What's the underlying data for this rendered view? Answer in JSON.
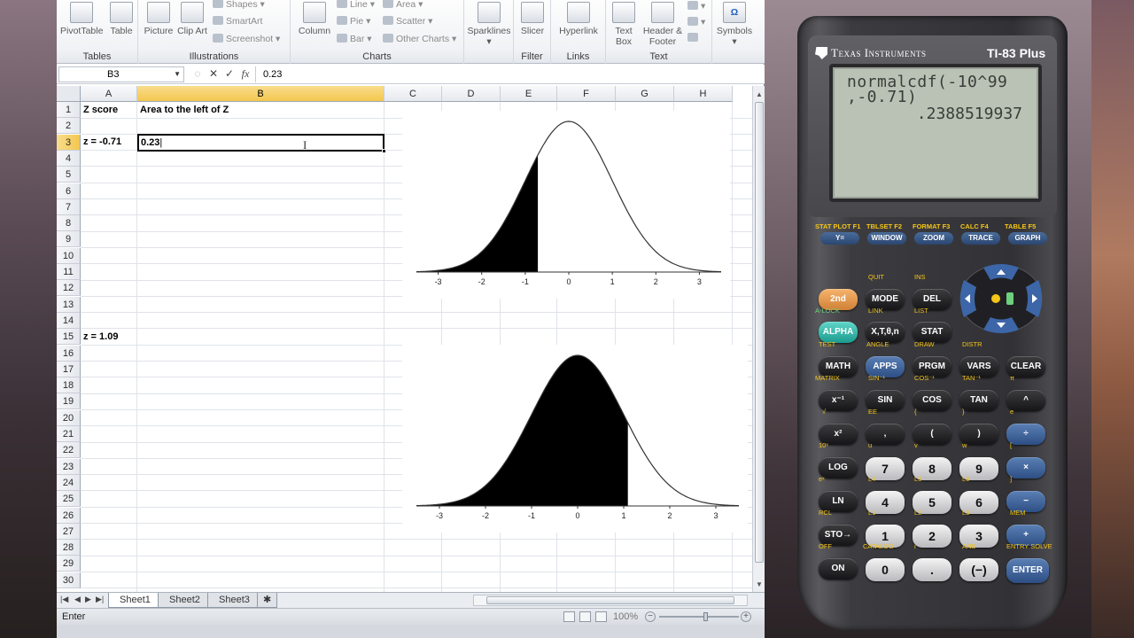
{
  "ribbon": {
    "groups": [
      {
        "title": "Tables",
        "buttons": [
          "PivotTable",
          "Table"
        ]
      },
      {
        "title": "Illustrations",
        "buttons": [
          "Picture",
          "Clip Art"
        ],
        "small": [
          "Shapes",
          "SmartArt",
          "Screenshot"
        ]
      },
      {
        "title": "Charts",
        "buttons": [
          "Column"
        ],
        "small": [
          "Line",
          "Pie",
          "Bar",
          "Area",
          "Scatter",
          "Other Charts"
        ]
      },
      {
        "title": "",
        "buttons": [
          "Sparklines"
        ]
      },
      {
        "title": "Filter",
        "buttons": [
          "Slicer"
        ]
      },
      {
        "title": "Links",
        "buttons": [
          "Hyperlink"
        ]
      },
      {
        "title": "Text",
        "buttons": [
          "Text Box",
          "Header & Footer"
        ]
      },
      {
        "title": "",
        "buttons": [
          "Symbols"
        ]
      }
    ]
  },
  "formula_bar": {
    "name_box": "B3",
    "cancel": "✕",
    "enter": "✓",
    "fx": "fx",
    "content": "0.23"
  },
  "columns": [
    "A",
    "B",
    "C",
    "D",
    "E",
    "F",
    "G",
    "H"
  ],
  "rows": [
    "1",
    "2",
    "3",
    "4",
    "5",
    "6",
    "7",
    "8",
    "9",
    "10",
    "11",
    "12",
    "13",
    "14",
    "15",
    "16",
    "17",
    "18",
    "19",
    "20",
    "21",
    "22",
    "23",
    "24",
    "25",
    "26",
    "27",
    "28",
    "29",
    "30"
  ],
  "cells": {
    "A1": "Z score",
    "B1": "Area to the left of Z",
    "A3": "z = -0.71",
    "B3": "0.23",
    "A15": "z = 1.09"
  },
  "charts": [
    {
      "type": "area",
      "shaded_left_of": -0.71,
      "x_ticks": [
        "-3",
        "-2",
        "-1",
        "0",
        "1",
        "2",
        "3"
      ]
    },
    {
      "type": "area",
      "shaded_left_of": 1.09,
      "x_ticks": [
        "-3",
        "-2",
        "-1",
        "0",
        "1",
        "2",
        "3"
      ]
    }
  ],
  "sheet_tabs": [
    "Sheet1",
    "Sheet2",
    "Sheet3"
  ],
  "status": {
    "mode": "Enter",
    "zoom": "100%"
  },
  "calculator": {
    "brand": "Texas Instruments",
    "model": "TI-83 Plus",
    "screen_line1": "normalcdf(-10^99",
    "screen_line2": ",-0.71)",
    "screen_result": ".2388519937",
    "fn_row_labels": [
      "STAT PLOT F1",
      "TBLSET F2",
      "FORMAT F3",
      "CALC F4",
      "TABLE F5"
    ],
    "fn_keys": [
      "Y=",
      "WINDOW",
      "ZOOM",
      "TRACE",
      "GRAPH"
    ],
    "keys": {
      "second": "2nd",
      "mode": "MODE",
      "del": "DEL",
      "alpha": "ALPHA",
      "xt": "X,T,θ,n",
      "stat": "STAT",
      "math": "MATH",
      "apps": "APPS",
      "prgm": "PRGM",
      "vars": "VARS",
      "clear": "CLEAR",
      "inv": "x⁻¹",
      "sin": "SIN",
      "cos": "COS",
      "tan": "TAN",
      "pow": "^",
      "sq": "x²",
      "comma": ",",
      "lparen": "(",
      "rparen": ")",
      "div": "÷",
      "log": "LOG",
      "k7": "7",
      "k8": "8",
      "k9": "9",
      "mul": "×",
      "ln": "LN",
      "k4": "4",
      "k5": "5",
      "k6": "6",
      "minus": "−",
      "sto": "STO→",
      "k1": "1",
      "k2": "2",
      "k3": "3",
      "plus": "+",
      "on": "ON",
      "k0": "0",
      "dot": ".",
      "neg": "(−)",
      "enter": "ENTER"
    },
    "second_labels": {
      "quit": "QUIT",
      "ins": "INS",
      "alock": "A-LOCK",
      "link": "LINK",
      "list": "LIST",
      "test": "TEST",
      "angle": "ANGLE",
      "draw": "DRAW",
      "distr": "DISTR",
      "matrix": "MATRIX",
      "sin_inv": "SIN⁻¹",
      "cos_inv": "COS⁻¹",
      "tan_inv": "TAN⁻¹",
      "pi": "π",
      "sqrt": "√",
      "ee": "EE",
      "lbrace": "{",
      "rbrace": "}",
      "e": "e",
      "tenx": "10ˣ",
      "u": "u",
      "v": "v",
      "w": "w",
      "lbrack": "[",
      "ex": "eˣ",
      "l4": "L4",
      "l5": "L5",
      "l6": "L6",
      "rbrack": "]",
      "rcl": "RCL",
      "l1": "L1",
      "l2": "L2",
      "l3": "L3",
      "mem": "MEM",
      "off": "OFF",
      "catalog": "CATALOG",
      "i": "i",
      "ans": "ANS",
      "entry_solve": "ENTRY SOLVE"
    }
  }
}
